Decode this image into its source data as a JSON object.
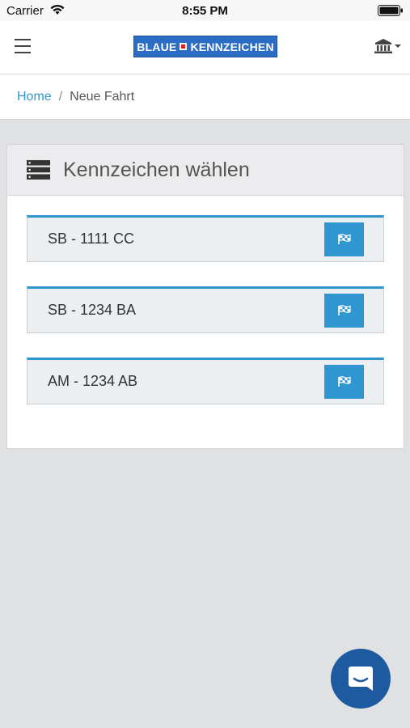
{
  "status_bar": {
    "carrier": "Carrier",
    "time": "8:55 PM"
  },
  "navbar": {
    "logo_left": "BLAUE",
    "logo_right": "KENNZEICHEN",
    "menu_icon": "hamburger-icon",
    "account_icon": "bank-icon"
  },
  "breadcrumb": {
    "home": "Home",
    "separator": "/",
    "current": "Neue Fahrt"
  },
  "panel": {
    "title": "Kennzeichen wählen",
    "icon": "server-list-icon",
    "plates": [
      {
        "label": "SB - 1111 CC",
        "button_icon": "checkered-flag-icon"
      },
      {
        "label": "SB - 1234 BA",
        "button_icon": "checkered-flag-icon"
      },
      {
        "label": "AM - 1234 AB",
        "button_icon": "checkered-flag-icon"
      }
    ]
  },
  "chat": {
    "icon": "chat-icon"
  },
  "colors": {
    "accent": "#2f96d0",
    "brand": "#2b6cc4",
    "chat": "#1d5aa0",
    "background": "#e0e1e3"
  }
}
